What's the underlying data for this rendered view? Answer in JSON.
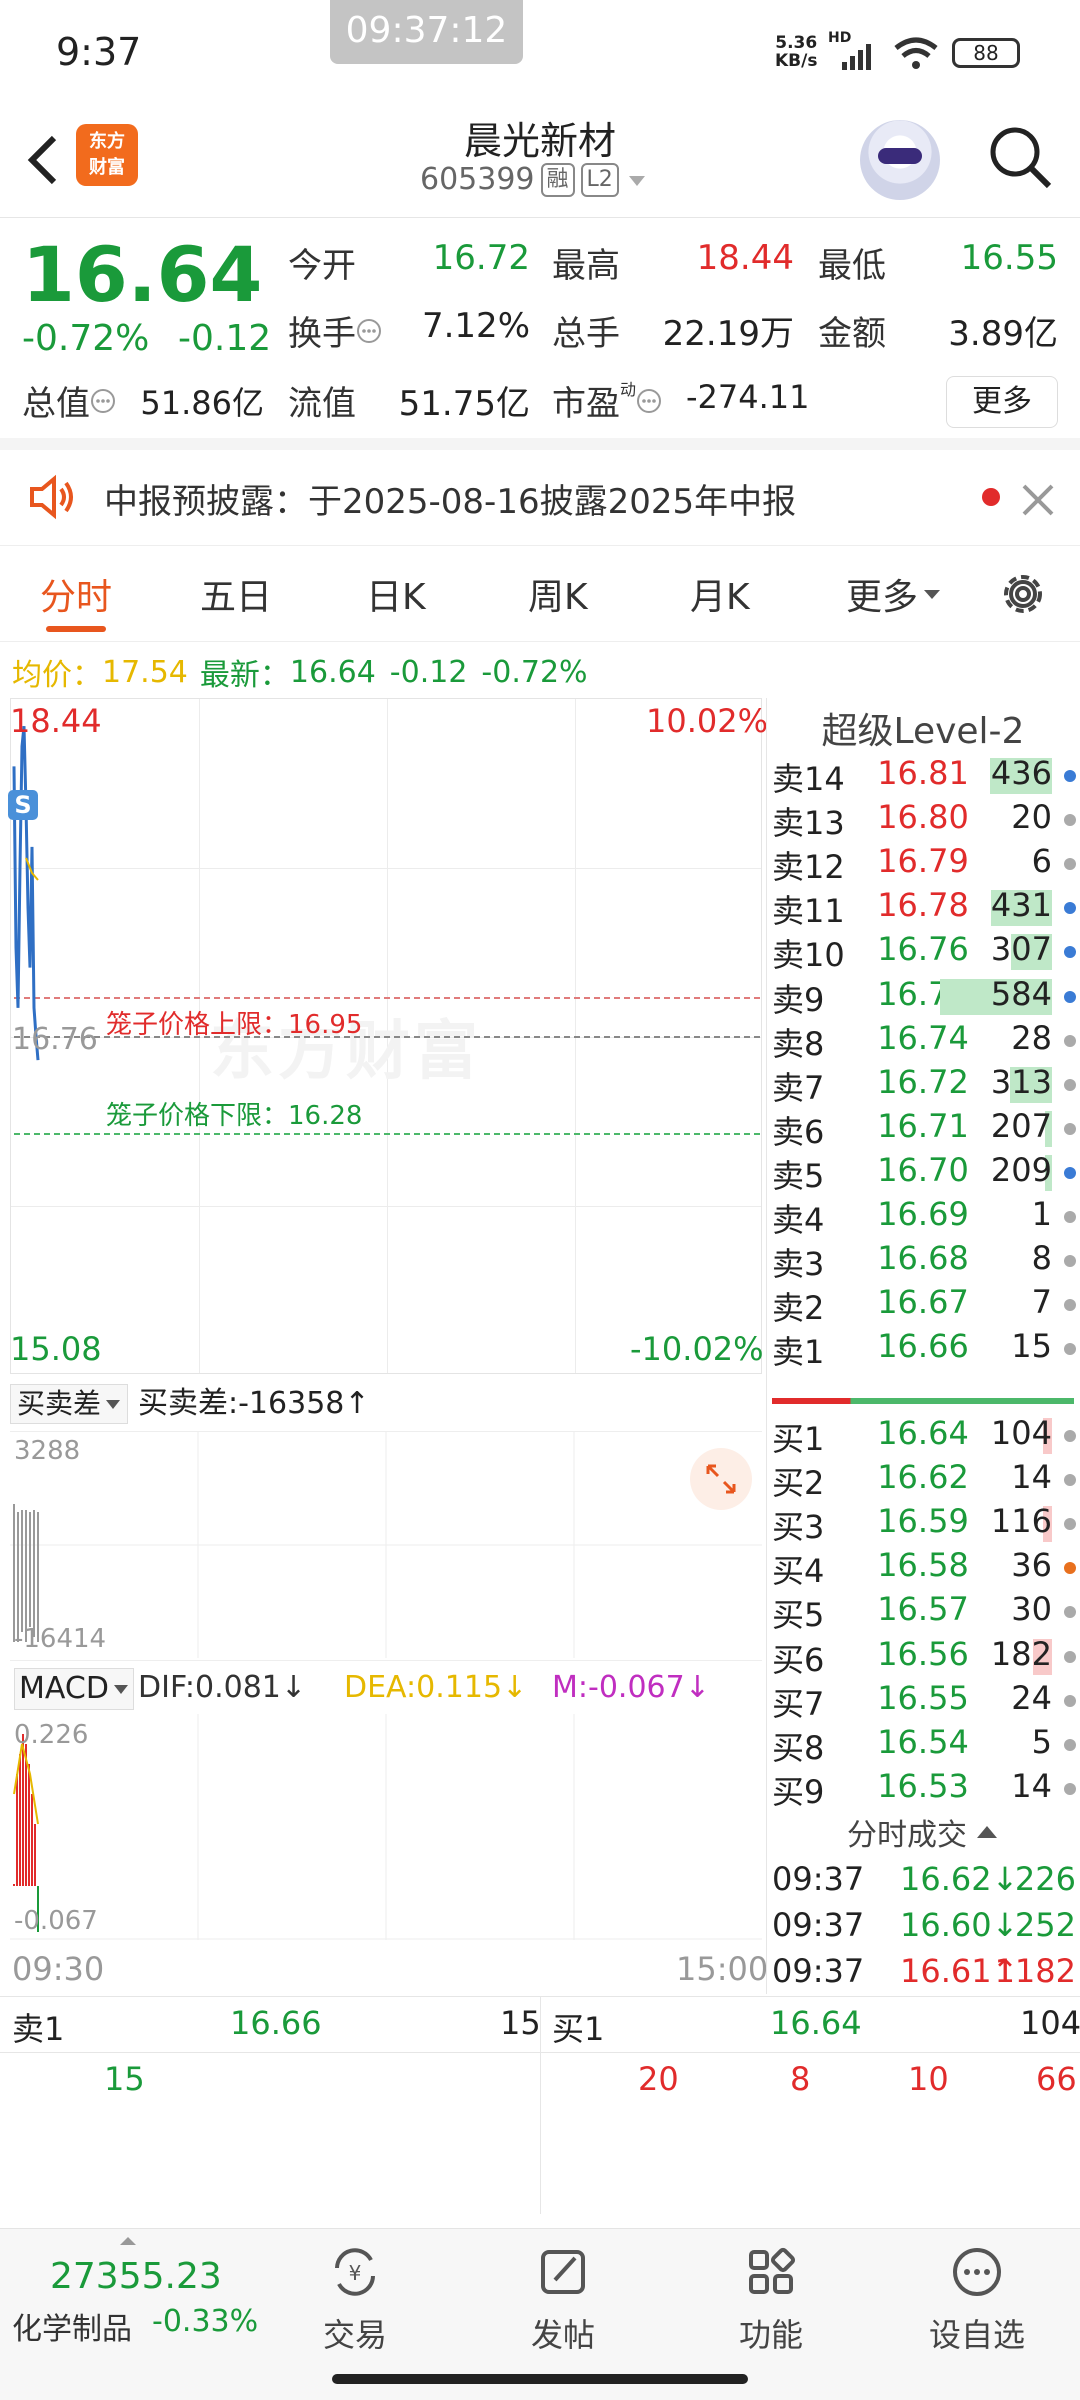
{
  "status": {
    "time": "9:37",
    "clock": "09:37:12",
    "net_speed": "5.36",
    "net_unit": "KB/s",
    "hd": "HD",
    "battery": "88"
  },
  "header": {
    "logo_line1": "东方",
    "logo_line2": "财富",
    "stock_name": "晨光新材",
    "stock_code": "605399",
    "tag_margin": "融",
    "tag_level": "L2"
  },
  "quote": {
    "price": "16.64",
    "change_pct": "-0.72%",
    "change_amt": "-0.12",
    "open_label": "今开",
    "open": "16.72",
    "high_label": "最高",
    "high": "18.44",
    "low_label": "最低",
    "low": "16.55",
    "turnover_label": "换手",
    "turnover": "7.12%",
    "volume_label": "总手",
    "volume": "22.19万",
    "amount_label": "金额",
    "amount": "3.89亿",
    "mktcap_label": "总值",
    "mktcap": "51.86亿",
    "float_label": "流值",
    "float": "51.75亿",
    "pe_label": "市盈",
    "pe_sup": "动",
    "pe": "-274.11",
    "more": "更多"
  },
  "notice": {
    "text": "中报预披露：于2025-08-16披露2025年中报"
  },
  "tabs": [
    "分时",
    "五日",
    "日K",
    "周K",
    "月K",
    "更多"
  ],
  "avg": {
    "avg_label": "均价：",
    "avg_value": "17.54",
    "latest_label": "最新：",
    "latest_value": "16.64",
    "chg": "-0.12",
    "pct": "-0.72%"
  },
  "chart": {
    "high": "18.44",
    "low": "15.08",
    "high_pct": "10.02%",
    "low_pct": "-10.02%",
    "current": "16.76",
    "cage_upper": "笼子价格上限：16.95",
    "cage_lower": "笼子价格下限：16.28",
    "watermark": "东方财富",
    "s_badge": "S",
    "price_range": [
      15.08,
      18.44
    ],
    "intraday_prices": [
      18.1,
      17.2,
      16.9,
      17.6,
      18.2,
      18.3,
      17.9,
      17.4,
      17.1,
      17.7,
      16.9,
      16.76,
      16.64
    ]
  },
  "sub1": {
    "selector": "买卖差",
    "value": "买卖差:-16358↑",
    "top": "3288",
    "bottom": "-16414"
  },
  "macd": {
    "selector": "MACD",
    "dif": "DIF:0.081↓",
    "dea": "DEA:0.115↓",
    "m": "M:-0.067↓",
    "top": "0.226",
    "bottom": "-0.067"
  },
  "time_axis": {
    "start": "09:30",
    "end": "15:00"
  },
  "level2": {
    "title": "超级Level-2",
    "asks": [
      {
        "label": "卖14",
        "price": "16.81",
        "vol": "436",
        "bar": 0.5,
        "dot": "#3a7bd5"
      },
      {
        "label": "卖13",
        "price": "16.80",
        "vol": "20",
        "bar": 0,
        "dot": "#aaaaaa"
      },
      {
        "label": "卖12",
        "price": "16.79",
        "vol": "6",
        "bar": 0,
        "dot": "#aaaaaa"
      },
      {
        "label": "卖11",
        "price": "16.78",
        "vol": "431",
        "bar": 0.49,
        "dot": "#3a7bd5"
      },
      {
        "label": "卖10",
        "price": "16.76",
        "vol": "307",
        "bar": 0.33,
        "dot": "#3a7bd5"
      },
      {
        "label": "卖9",
        "price": "16.75",
        "vol": "584",
        "bar": 0.9,
        "dot": "#3a7bd5"
      },
      {
        "label": "卖8",
        "price": "16.74",
        "vol": "28",
        "bar": 0,
        "dot": "#aaaaaa"
      },
      {
        "label": "卖7",
        "price": "16.72",
        "vol": "313",
        "bar": 0.34,
        "dot": "#aaaaaa"
      },
      {
        "label": "卖6",
        "price": "16.71",
        "vol": "207",
        "bar": 0.06,
        "dot": "#aaaaaa"
      },
      {
        "label": "卖5",
        "price": "16.70",
        "vol": "209",
        "bar": 0.06,
        "dot": "#3a7bd5"
      },
      {
        "label": "卖4",
        "price": "16.69",
        "vol": "1",
        "bar": 0,
        "dot": "#aaaaaa"
      },
      {
        "label": "卖3",
        "price": "16.68",
        "vol": "8",
        "bar": 0,
        "dot": "#aaaaaa"
      },
      {
        "label": "卖2",
        "price": "16.67",
        "vol": "7",
        "bar": 0,
        "dot": "#aaaaaa"
      },
      {
        "label": "卖1",
        "price": "16.66",
        "vol": "15",
        "bar": 0,
        "dot": "#aaaaaa"
      }
    ],
    "bids": [
      {
        "label": "买1",
        "price": "16.64",
        "vol": "104",
        "bar": 0.07,
        "dot": "#aaaaaa"
      },
      {
        "label": "买2",
        "price": "16.62",
        "vol": "14",
        "bar": 0,
        "dot": "#aaaaaa"
      },
      {
        "label": "买3",
        "price": "16.59",
        "vol": "116",
        "bar": 0.07,
        "dot": "#aaaaaa"
      },
      {
        "label": "买4",
        "price": "16.58",
        "vol": "36",
        "bar": 0,
        "dot": "#e8701e"
      },
      {
        "label": "买5",
        "price": "16.57",
        "vol": "30",
        "bar": 0,
        "dot": "#aaaaaa"
      },
      {
        "label": "买6",
        "price": "16.56",
        "vol": "182",
        "bar": 0.15,
        "dot": "#aaaaaa"
      },
      {
        "label": "买7",
        "price": "16.55",
        "vol": "24",
        "bar": 0,
        "dot": "#aaaaaa"
      },
      {
        "label": "买8",
        "price": "16.54",
        "vol": "5",
        "bar": 0,
        "dot": "#aaaaaa"
      },
      {
        "label": "买9",
        "price": "16.53",
        "vol": "14",
        "bar": 0,
        "dot": "#aaaaaa"
      }
    ],
    "trades_title": "分时成交",
    "trades": [
      {
        "time": "09:37",
        "price": "16.62↓",
        "vol": "226",
        "dir": "down"
      },
      {
        "time": "09:37",
        "price": "16.60↓",
        "vol": "252",
        "dir": "down"
      },
      {
        "time": "09:37",
        "price": "16.61↑",
        "vol": "1182",
        "dir": "up"
      }
    ]
  },
  "strip": {
    "ask_label": "卖1",
    "ask_price": "16.66",
    "ask_vol": "15",
    "ask_orders": [
      "15"
    ],
    "bid_label": "买1",
    "bid_price": "16.64",
    "bid_vol": "104",
    "bid_orders": [
      "20",
      "8",
      "10",
      "66"
    ]
  },
  "bottom_nav": {
    "index_value": "27355.23",
    "index_name": "化学制品",
    "index_change": "-0.33%",
    "items": [
      "交易",
      "发帖",
      "功能",
      "设自选"
    ]
  },
  "colors": {
    "up": "#e12b2b",
    "down": "#1a9a3a",
    "accent": "#e8561e"
  }
}
